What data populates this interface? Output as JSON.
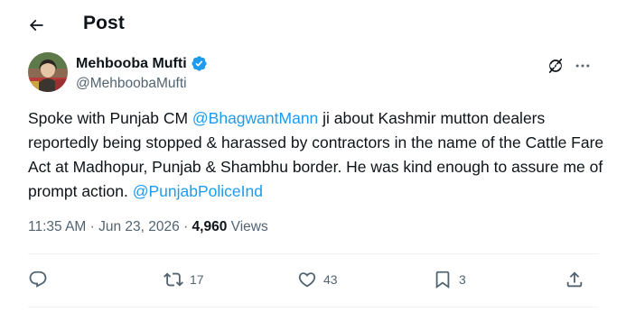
{
  "header": {
    "title": "Post",
    "back_icon": "arrow-left-icon"
  },
  "author": {
    "name": "Mehbooba Mufti",
    "handle": "@MehboobaMufti",
    "verified": true,
    "verified_color": "#1d9bf0"
  },
  "tweet": {
    "segments": [
      {
        "text": "Spoke with Punjab CM ",
        "type": "text"
      },
      {
        "text": "@BhagwantMann",
        "type": "mention"
      },
      {
        "text": " ji about  Kashmir mutton dealers reportedly being stopped & harassed by contractors in the name of the Cattle Fare Act at Madhopur, Punjab & Shambhu border. He was kind enough to assure me of prompt action. ",
        "type": "text"
      },
      {
        "text": "@PunjabPoliceInd",
        "type": "mention"
      }
    ]
  },
  "meta": {
    "time": "11:35 AM",
    "separator": " · ",
    "date": "Jun 23, 2026",
    "views_count": "4,960",
    "views_label": " Views"
  },
  "actions": {
    "reply": {
      "icon": "reply-icon",
      "count": ""
    },
    "repost": {
      "icon": "repost-icon",
      "count": "17"
    },
    "like": {
      "icon": "heart-icon",
      "count": "43"
    },
    "bookmark": {
      "icon": "bookmark-icon",
      "count": "3"
    },
    "share": {
      "icon": "share-icon",
      "count": ""
    }
  },
  "colors": {
    "accent": "#1d9bf0",
    "text": "#0f1419",
    "secondary": "#536471",
    "divider": "#eff3f4"
  }
}
